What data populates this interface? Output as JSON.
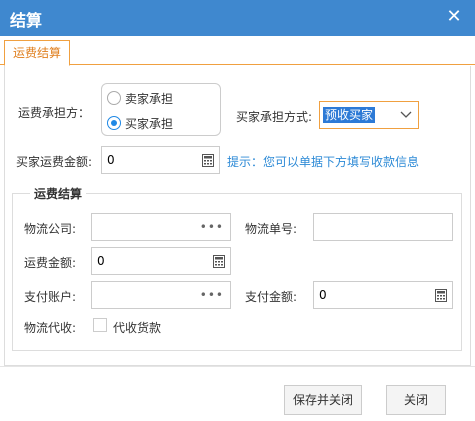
{
  "window": {
    "title": "结算",
    "close_glyph": "✕"
  },
  "tabs": [
    {
      "label": "运费结算"
    }
  ],
  "freight_payer": {
    "label": "运费承担方：",
    "options": [
      {
        "label": "卖家承担",
        "selected": false
      },
      {
        "label": "买家承担",
        "selected": true
      }
    ]
  },
  "buyer_mode": {
    "label": "买家承担方式:",
    "value": "预收买家"
  },
  "buyer_amount": {
    "label": "买家运费金额:",
    "value": "0"
  },
  "hint": "提示：您可以单据下方填写收款信息",
  "section": {
    "legend": "运费结算",
    "company": {
      "label": "物流公司:",
      "value": ""
    },
    "tracking": {
      "label": "物流单号:",
      "value": ""
    },
    "freight_amount": {
      "label": "运费金额:",
      "value": "0"
    },
    "pay_account": {
      "label": "支付账户:",
      "value": ""
    },
    "pay_amount": {
      "label": "支付金额:",
      "value": "0"
    },
    "cod": {
      "label": "物流代收:",
      "checkbox_label": "代收货款",
      "checked": false
    }
  },
  "buttons": {
    "save_close": "保存并关闭",
    "close": "关闭"
  },
  "colors": {
    "titlebar": "#3f88cf",
    "tab_accent": "#f0a040",
    "hint": "#2d8ad6",
    "selection": "#2d7ad6"
  },
  "icons": [
    "close-icon",
    "chevron-down-icon",
    "calculator-icon",
    "ellipsis-icon"
  ]
}
